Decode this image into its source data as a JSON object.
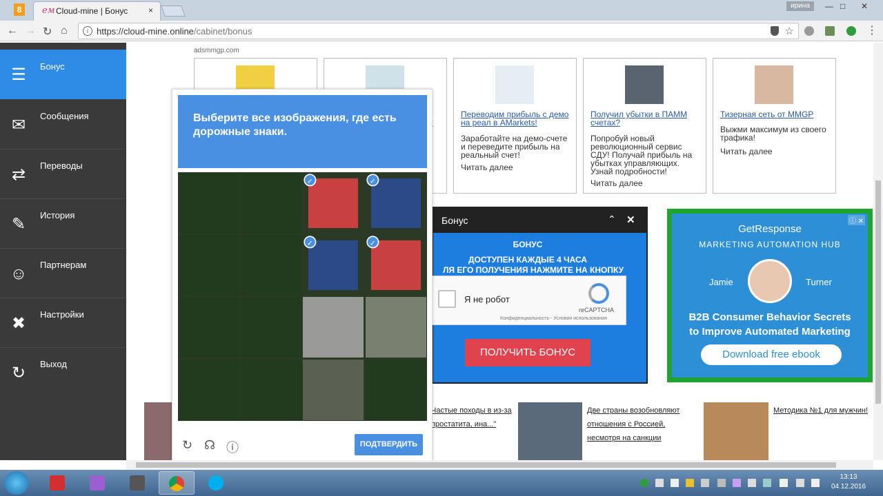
{
  "browser": {
    "tab_title": "Cloud-mine | Бонус",
    "tab_favicon": "ем",
    "tab_close": "×",
    "user_badge": "ирина",
    "url_main": "https://cloud-mine.online",
    "url_path": "/cabinet/bonus",
    "win_min": "—",
    "win_max": "□",
    "win_close": "✕"
  },
  "sidebar": {
    "items": [
      {
        "label": "Бонус",
        "icon": "database-plus-icon",
        "glyph": "☰"
      },
      {
        "label": "Сообщения",
        "icon": "envelope-icon",
        "glyph": "✉"
      },
      {
        "label": "Переводы",
        "icon": "transfer-icon",
        "glyph": "⇄"
      },
      {
        "label": "История",
        "icon": "pencil-icon",
        "glyph": "✎"
      },
      {
        "label": "Партнерам",
        "icon": "people-icon",
        "glyph": "☺"
      },
      {
        "label": "Настройки",
        "icon": "tools-icon",
        "glyph": "✖"
      },
      {
        "label": "Выход",
        "icon": "logout-icon",
        "glyph": "↻"
      }
    ]
  },
  "ads": {
    "source": "adsmmgp.com",
    "teasers": [
      {
        "title": "",
        "desc": "",
        "more": ""
      },
      {
        "title": "",
        "desc": "",
        "more": ""
      },
      {
        "title": "Переводим прибыль с демо на реал в AMarkets!",
        "desc": "Заработайте на демо-счете и переведите прибыль на реальный счет!",
        "more": "Читать далее"
      },
      {
        "title": "Получил убытки в ПАММ счетах?",
        "desc": "Попробуй новый революционный сервис СДУ! Получай прибыль на убытках управляющих. Узнай подробности!",
        "more": "Читать далее"
      },
      {
        "title": "Тизерная сеть от MMGP",
        "desc": "Выжми максимум из своего трафика!",
        "more": "Читать далее"
      }
    ],
    "partial_teaser_marks": [
      "?",
      "й",
      "ь"
    ]
  },
  "bonus": {
    "header": "Бонус",
    "title": "БОНУС",
    "line1": "ДОСТУПЕН КАЖДЫЕ 4 ЧАСА",
    "line2": "ЛЯ ЕГО ПОЛУЧЕНИЯ НАЖМИТЕ НА КНОПКУ",
    "recaptcha_label": "Я не робот",
    "recaptcha_brand": "reCAPTCHA",
    "recaptcha_terms": "Конфиденциальность - Условия использования",
    "button": "ПОЛУЧИТЬ БОНУС",
    "collapse": "⌃",
    "close": "✕"
  },
  "banner": {
    "brand": "GetResponse",
    "hub": "MARKETING AUTOMATION HUB",
    "name_first": "Jamie",
    "name_last": "Turner",
    "headline1": "B2B Consumer Behavior Secrets",
    "headline2": "to Improve Automated Marketing",
    "cta": "Download free ebook",
    "ad_choices": "ⓘ ✕"
  },
  "news": [
    {
      "text": "Частые походы в из-за простатита, ина...\""
    },
    {
      "text": "Две страны возобновляют отношения с Россией, несмотря на санкции"
    },
    {
      "text": "Методика №1 для мужчин!"
    }
  ],
  "captcha": {
    "instruction": "Выберите все изображения, где есть дорожные знаки.",
    "confirm": "ПОДТВЕРДИТЬ",
    "selected_tiles": [
      2,
      3,
      6,
      7
    ],
    "check": "✓",
    "reload_icon": "↻",
    "audio_icon": "☊",
    "info_icon": "ⓘ"
  },
  "taskbar": {
    "time": "13:13",
    "date": "04.12.2016"
  }
}
